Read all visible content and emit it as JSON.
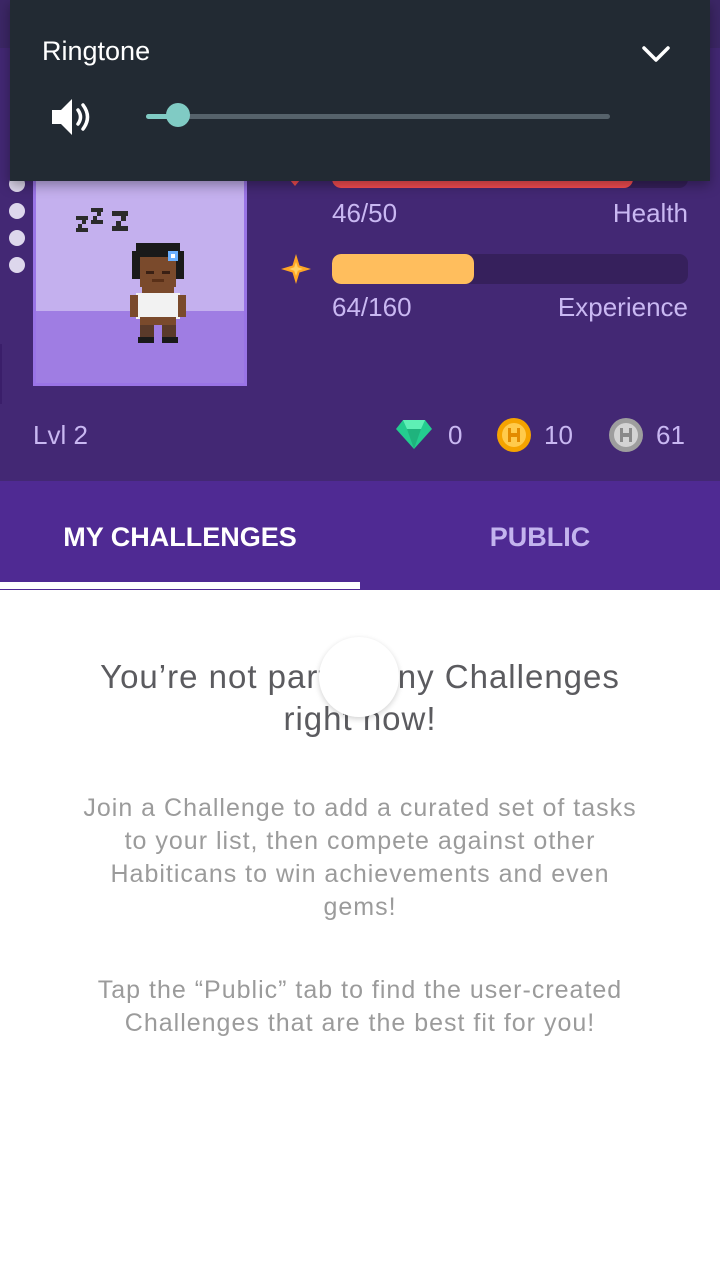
{
  "colors": {
    "header_bg": "#432874",
    "tabs_bg": "#4f2a93",
    "health_fill": "#f74e52",
    "experience_fill": "#ffbe5d",
    "volume_accent": "#80cbc4",
    "volume_panel_bg": "#222a33"
  },
  "volume_panel": {
    "title": "Ringtone",
    "level_fraction": 0.07,
    "speaker_icon": "speaker-icon",
    "collapse_icon": "chevron-down-icon"
  },
  "header": {
    "health": {
      "icon": "heart-icon",
      "current": 46,
      "max": 50,
      "value_text": "46/50",
      "label": "Health"
    },
    "experience": {
      "icon": "star-icon",
      "current": 64,
      "max": 160,
      "value_text": "64/160",
      "label": "Experience"
    },
    "level": "Lvl 2",
    "currencies": [
      {
        "icon": "gem-icon",
        "value": "0"
      },
      {
        "icon": "gold-coin-icon",
        "value": "10"
      },
      {
        "icon": "silver-coin-icon",
        "value": "61"
      }
    ]
  },
  "tabs": [
    {
      "label": "MY CHALLENGES",
      "active": true
    },
    {
      "label": "PUBLIC",
      "active": false
    }
  ],
  "empty_state": {
    "title": "You’re not part of any Challenges right now!",
    "description": "Join a Challenge to add a curated set of tasks to your list, then compete against other Habiticans to win achievements and even gems!",
    "hint": "Tap the “Public” tab to find the user-created Challenges that are the best fit for you!"
  }
}
